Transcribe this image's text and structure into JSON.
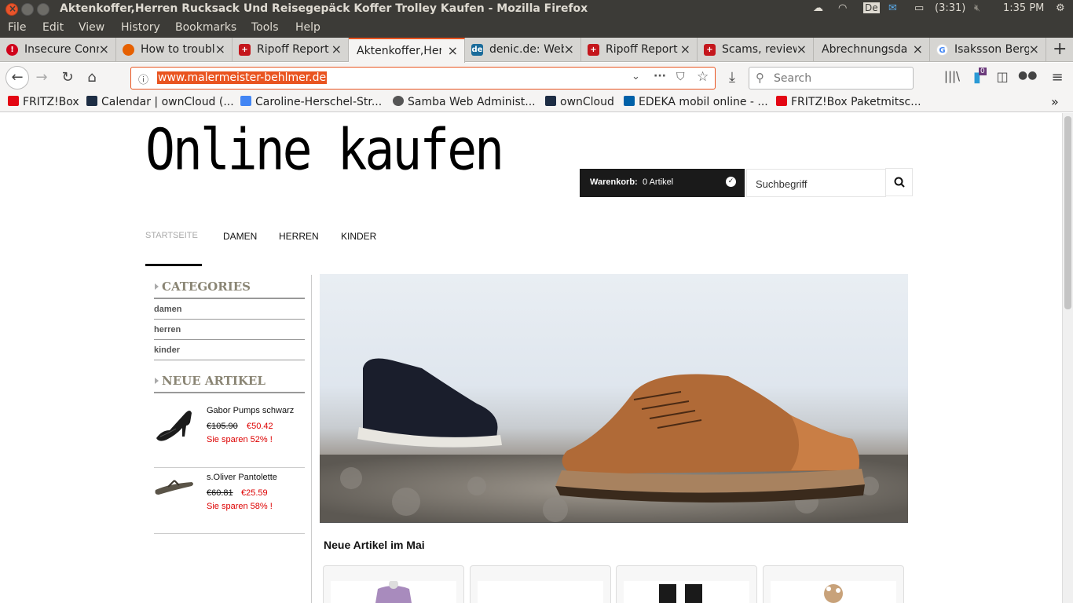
{
  "window": {
    "title": "Aktenkoffer,Herren Rucksack Und Reisegepäck Koffer Trolley Kaufen - Mozilla Firefox",
    "tray": {
      "keyboard": "De",
      "battery": "(3:31)",
      "clock": "1:35 PM"
    }
  },
  "menu": [
    "File",
    "Edit",
    "View",
    "History",
    "Bookmarks",
    "Tools",
    "Help"
  ],
  "tabs": [
    {
      "label": "Insecure Connection",
      "icon": "warning-icon",
      "color": "#d0021b"
    },
    {
      "label": "How to troubleshoot",
      "icon": "firefox-icon",
      "color": "#e66000"
    },
    {
      "label": "Ripoff Report",
      "icon": "ripoff-report-icon",
      "color": "#c4161c"
    },
    {
      "label": "Aktenkoffer,Herren",
      "icon": "",
      "color": "",
      "active": true
    },
    {
      "label": "denic.de: Webwhois",
      "icon": "denic-icon",
      "color": "#1a6b9a"
    },
    {
      "label": "Ripoff Report",
      "icon": "ripoff-report-icon",
      "color": "#c4161c"
    },
    {
      "label": "Scams, reviews",
      "icon": "ripoff-report-icon",
      "color": "#c4161c"
    },
    {
      "label": "Abrechnungsdaten",
      "icon": "",
      "color": ""
    },
    {
      "label": "Isaksson Berg",
      "icon": "google-icon",
      "color": "#4285f4"
    }
  ],
  "nav": {
    "url": "www.malermeister-behlmer.de",
    "search_placeholder": "Search",
    "notification_count": "0"
  },
  "bookmarks": [
    {
      "label": "FRITZ!Box",
      "color": "#e30613"
    },
    {
      "label": "Calendar | ownCloud (...",
      "color": "#1d2d44"
    },
    {
      "label": "Caroline-Herschel-Str...",
      "color": "#4285f4"
    },
    {
      "label": "Samba Web Administ...",
      "color": "#555555"
    },
    {
      "label": "ownCloud",
      "color": "#1d2d44"
    },
    {
      "label": "EDEKA mobil online - ...",
      "color": "#0061a8"
    },
    {
      "label": "FRITZ!Box Paketmitsc...",
      "color": "#e30613"
    }
  ],
  "site": {
    "logo": "Online kaufen",
    "cart": {
      "label": "Warenkorb:",
      "count": "0 Artikel"
    },
    "search_placeholder": "Suchbegriff",
    "nav": [
      "STARTSEITE",
      "DAMEN",
      "HERREN",
      "KINDER"
    ],
    "categories_title": "CATEGORIES",
    "categories": [
      "damen",
      "herren",
      "kinder"
    ],
    "new_title": "NEUE ARTIKEL",
    "new_items": [
      {
        "name": "Gabor Pumps schwarz",
        "old_price": "€105.90 ",
        "new_price": "€50.42",
        "savings": "Sie sparen 52% !"
      },
      {
        "name": "s.Oliver Pantolette",
        "old_price": "€60.81 ",
        "new_price": "€25.59",
        "savings": "Sie sparen 58% !"
      }
    ],
    "section_title": "Neue Artikel im Mai"
  },
  "colors": {
    "accent": "#e95420",
    "price_red": "#dd0000",
    "cart_bg": "#1a1a1a"
  }
}
